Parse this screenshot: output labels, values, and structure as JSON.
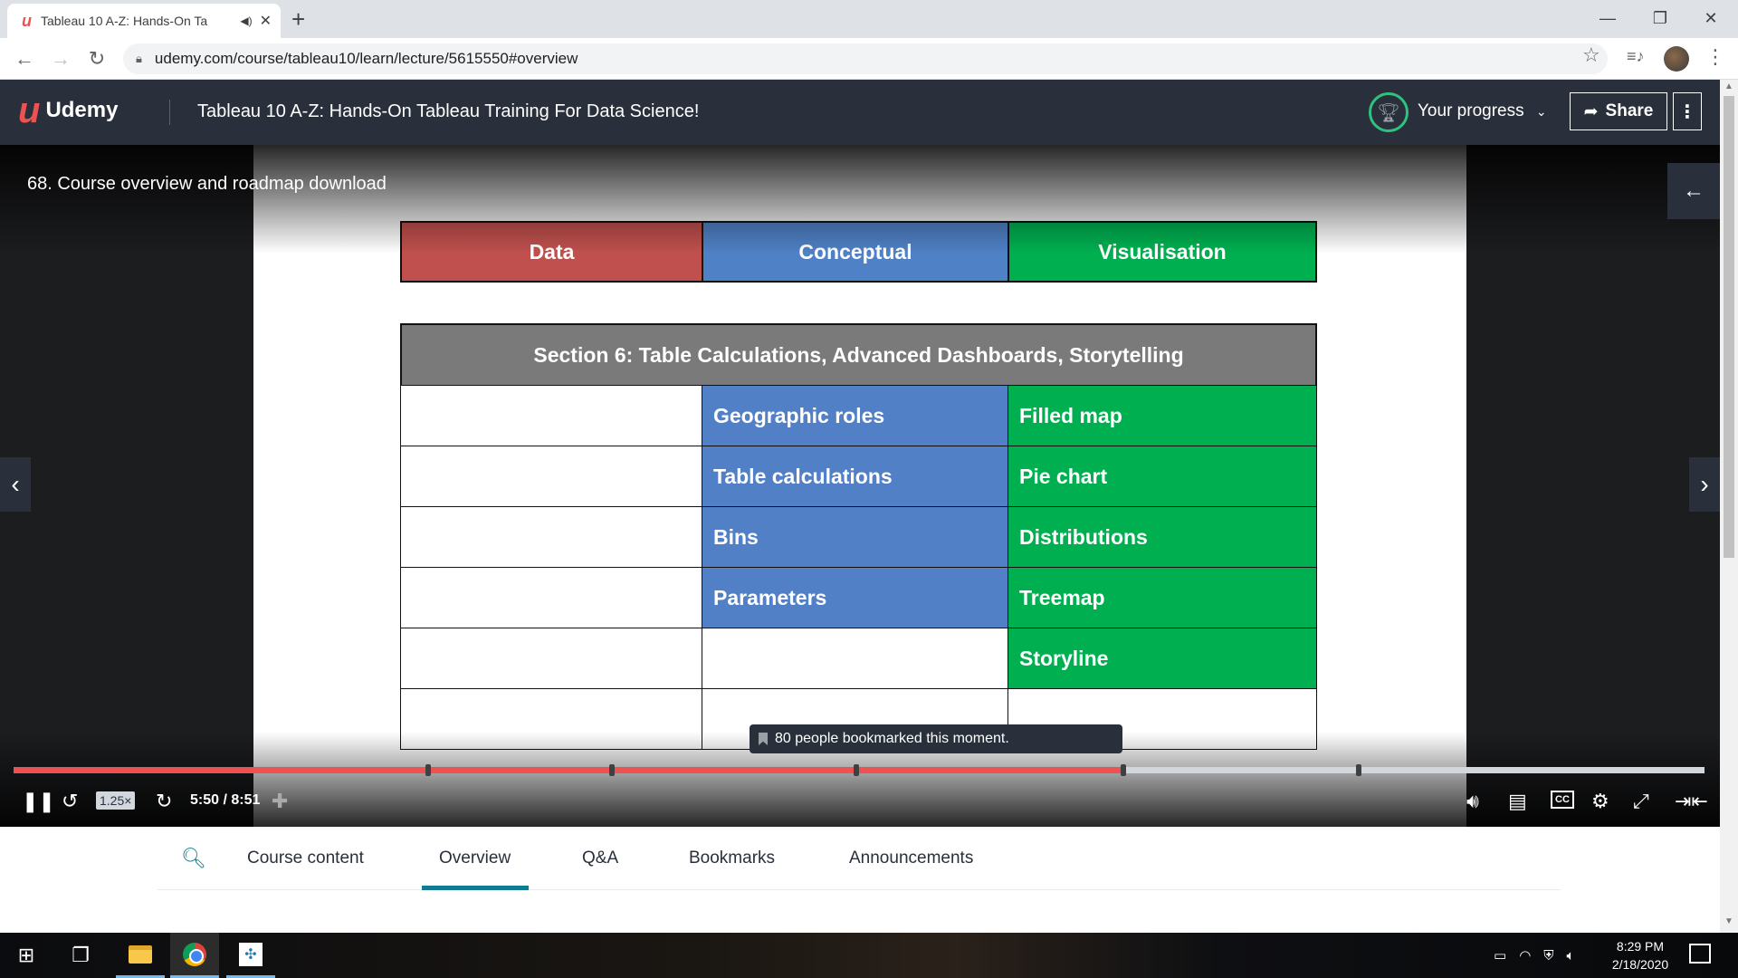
{
  "browser": {
    "tab_title": "Tableau 10 A-Z: Hands-On Ta",
    "url": "udemy.com/course/tableau10/learn/lecture/5615550#overview"
  },
  "header": {
    "brand": "Udemy",
    "course_title": "Tableau 10 A-Z: Hands-On Tableau Training For Data Science!",
    "progress_label": "Your progress",
    "share_label": "Share"
  },
  "lecture": {
    "title": "68. Course overview and roadmap download"
  },
  "slide": {
    "categories": [
      "Data",
      "Conceptual",
      "Visualisation"
    ],
    "category_colors": [
      "#c0504d",
      "#4f81c6",
      "#00b050"
    ],
    "section_title": "Section 6: Table Calculations, Advanced Dashboards, Storytelling",
    "rows": [
      [
        "",
        "Geographic roles",
        "Filled map"
      ],
      [
        "",
        "Table calculations",
        "Pie chart"
      ],
      [
        "",
        "Bins",
        "Distributions"
      ],
      [
        "",
        "Parameters",
        "Treemap"
      ],
      [
        "",
        "",
        "Storyline"
      ],
      [
        "",
        "",
        ""
      ]
    ]
  },
  "player": {
    "bookmark_tooltip": "80 people bookmarked this moment.",
    "playback_rate": "1.25×",
    "time": "5:50 / 8:51",
    "played_fraction": 0.656,
    "cc_label": "CC"
  },
  "tabs": [
    "Course content",
    "Overview",
    "Q&A",
    "Bookmarks",
    "Announcements"
  ],
  "active_tab": "Overview",
  "taskbar": {
    "time": "8:29 PM",
    "date": "2/18/2020"
  }
}
